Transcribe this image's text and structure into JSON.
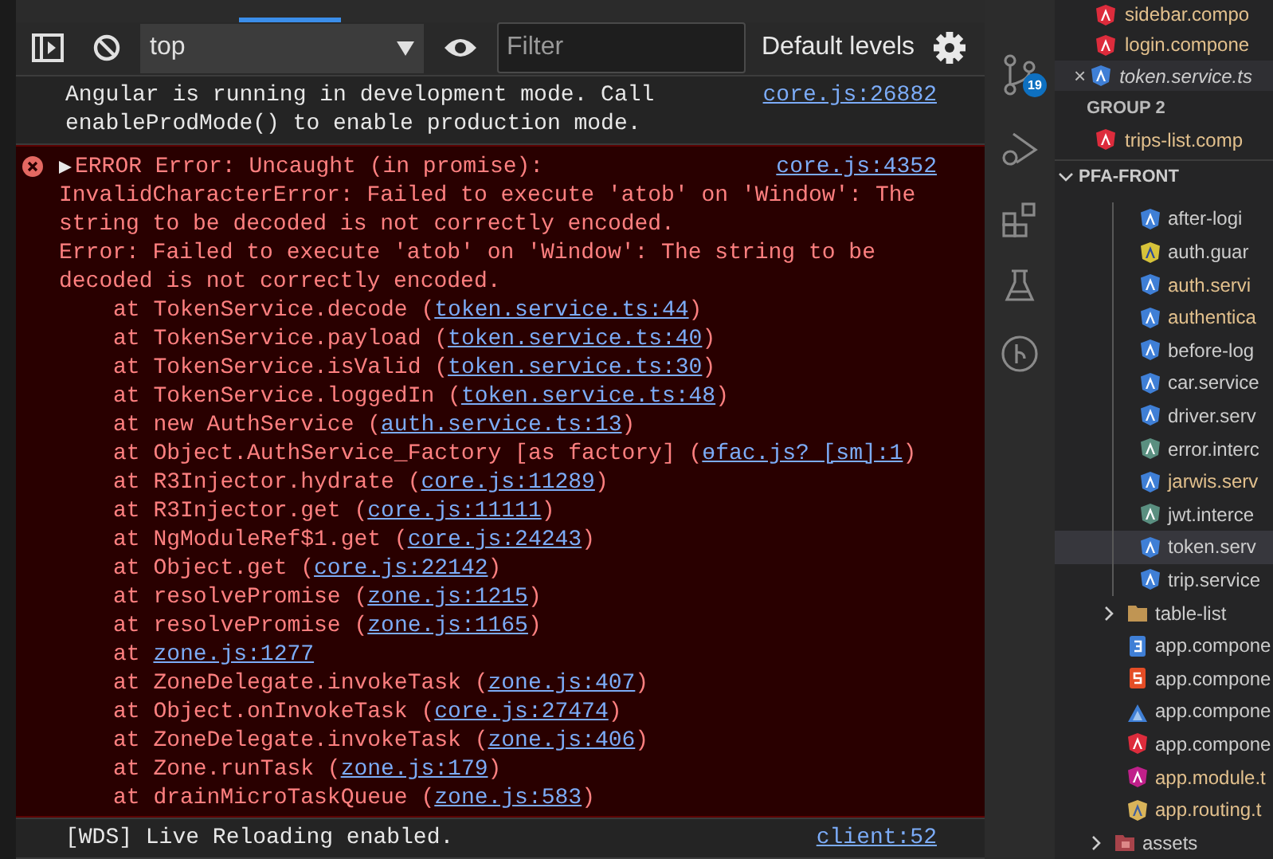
{
  "toolbar": {
    "context": "top",
    "filter": {
      "placeholder": "Filter"
    },
    "levels": "Default levels"
  },
  "messages": [
    {
      "kind": "info",
      "text": "Angular is running in development mode. Call enableProdMode() to enable production mode.",
      "source": "core.js:26882"
    },
    {
      "kind": "error",
      "expanded": false,
      "text": "ERROR Error: Uncaught (in promise):",
      "source": "core.js:4352",
      "details": [
        "InvalidCharacterError: Failed to execute 'atob' on 'Window': The string to be decoded is not correctly encoded.",
        "Error: Failed to execute 'atob' on 'Window': The string to be decoded is not correctly encoded."
      ],
      "frames": [
        {
          "prefix": "at TokenService.decode (",
          "link": "token.service.ts:44",
          "suffix": ")"
        },
        {
          "prefix": "at TokenService.payload (",
          "link": "token.service.ts:40",
          "suffix": ")"
        },
        {
          "prefix": "at TokenService.isValid (",
          "link": "token.service.ts:30",
          "suffix": ")"
        },
        {
          "prefix": "at TokenService.loggedIn (",
          "link": "token.service.ts:48",
          "suffix": ")"
        },
        {
          "prefix": "at new AuthService (",
          "link": "auth.service.ts:13",
          "suffix": ")"
        },
        {
          "prefix": "at Object.AuthService_Factory [as factory] (",
          "link": "ɵfac.js? [sm]:1",
          "suffix": ")"
        },
        {
          "prefix": "at R3Injector.hydrate (",
          "link": "core.js:11289",
          "suffix": ")"
        },
        {
          "prefix": "at R3Injector.get (",
          "link": "core.js:11111",
          "suffix": ")"
        },
        {
          "prefix": "at NgModuleRef$1.get (",
          "link": "core.js:24243",
          "suffix": ")"
        },
        {
          "prefix": "at Object.get (",
          "link": "core.js:22142",
          "suffix": ")"
        },
        {
          "prefix": "at resolvePromise (",
          "link": "zone.js:1215",
          "suffix": ")"
        },
        {
          "prefix": "at resolvePromise (",
          "link": "zone.js:1165",
          "suffix": ")"
        },
        {
          "prefix": "at ",
          "link": "zone.js:1277"
        },
        {
          "prefix": "at ZoneDelegate.invokeTask (",
          "link": "zone.js:407",
          "suffix": ")"
        },
        {
          "prefix": "at Object.onInvokeTask (",
          "link": "core.js:27474",
          "suffix": ")"
        },
        {
          "prefix": "at ZoneDelegate.invokeTask (",
          "link": "zone.js:406",
          "suffix": ")"
        },
        {
          "prefix": "at Zone.runTask (",
          "link": "zone.js:179",
          "suffix": ")"
        },
        {
          "prefix": "at drainMicroTaskQueue (",
          "link": "zone.js:583",
          "suffix": ")"
        }
      ]
    },
    {
      "kind": "info",
      "text": "[WDS] Live Reloading enabled.",
      "source": "client:52"
    }
  ],
  "activity_bar": {
    "source_control_badge": "19"
  },
  "open_editors": [
    {
      "kind": "component",
      "label": "sidebar.compo",
      "modified": true,
      "selected": false
    },
    {
      "kind": "component",
      "label": "login.compone",
      "modified": true,
      "selected": false
    },
    {
      "kind": "service",
      "label": "token.service.ts",
      "modified": false,
      "selected": true,
      "close": "×"
    },
    {
      "kind": "group",
      "label": "GROUP 2"
    },
    {
      "kind": "component",
      "label": "trips-list.comp",
      "modified": true,
      "selected": false
    }
  ],
  "explorer": {
    "title": "PFA-FRONT",
    "expanded": true,
    "items": [
      {
        "kind": "folder",
        "children": [
          {
            "kind": "folder",
            "expanded": true,
            "children": [
              {
                "kind": "service",
                "label": "after-logi",
                "modified": false,
                "selected": false
              },
              {
                "kind": "guard",
                "label": "auth.guar",
                "modified": false,
                "selected": false
              },
              {
                "kind": "service",
                "label": "auth.servi",
                "modified": true,
                "selected": false
              },
              {
                "kind": "service",
                "label": "authentica",
                "modified": true,
                "selected": false
              },
              {
                "kind": "service",
                "label": "before-log",
                "modified": false,
                "selected": false
              },
              {
                "kind": "service",
                "label": "car.service",
                "modified": false,
                "selected": false
              },
              {
                "kind": "service",
                "label": "driver.serv",
                "modified": false,
                "selected": false
              },
              {
                "kind": "interceptor",
                "label": "error.interc",
                "modified": false,
                "selected": false
              },
              {
                "kind": "service",
                "label": "jarwis.serv",
                "modified": true,
                "selected": false
              },
              {
                "kind": "interceptor",
                "label": "jwt.interce",
                "modified": false,
                "selected": false
              },
              {
                "kind": "service",
                "label": "token.serv",
                "modified": false,
                "selected": true
              },
              {
                "kind": "service",
                "label": "trip.service",
                "modified": false,
                "selected": false
              }
            ]
          },
          {
            "kind": "folder",
            "label": "table-list",
            "expanded": false,
            "selected": false
          },
          {
            "kind": "stylesheet",
            "label": "app.compone",
            "modified": false,
            "selected": false
          },
          {
            "kind": "template",
            "label": "app.compone",
            "modified": false,
            "selected": false
          },
          {
            "kind": "spec",
            "label": "app.compone",
            "modified": false,
            "selected": false
          },
          {
            "kind": "component",
            "label": "app.compone",
            "modified": false,
            "selected": false
          },
          {
            "kind": "module",
            "label": "app.module.t",
            "modified": true,
            "selected": false
          },
          {
            "kind": "routing",
            "label": "app.routing.t",
            "modified": true,
            "selected": false
          }
        ]
      },
      {
        "kind": "assets",
        "label": "assets",
        "expanded": false,
        "selected": false
      }
    ]
  }
}
